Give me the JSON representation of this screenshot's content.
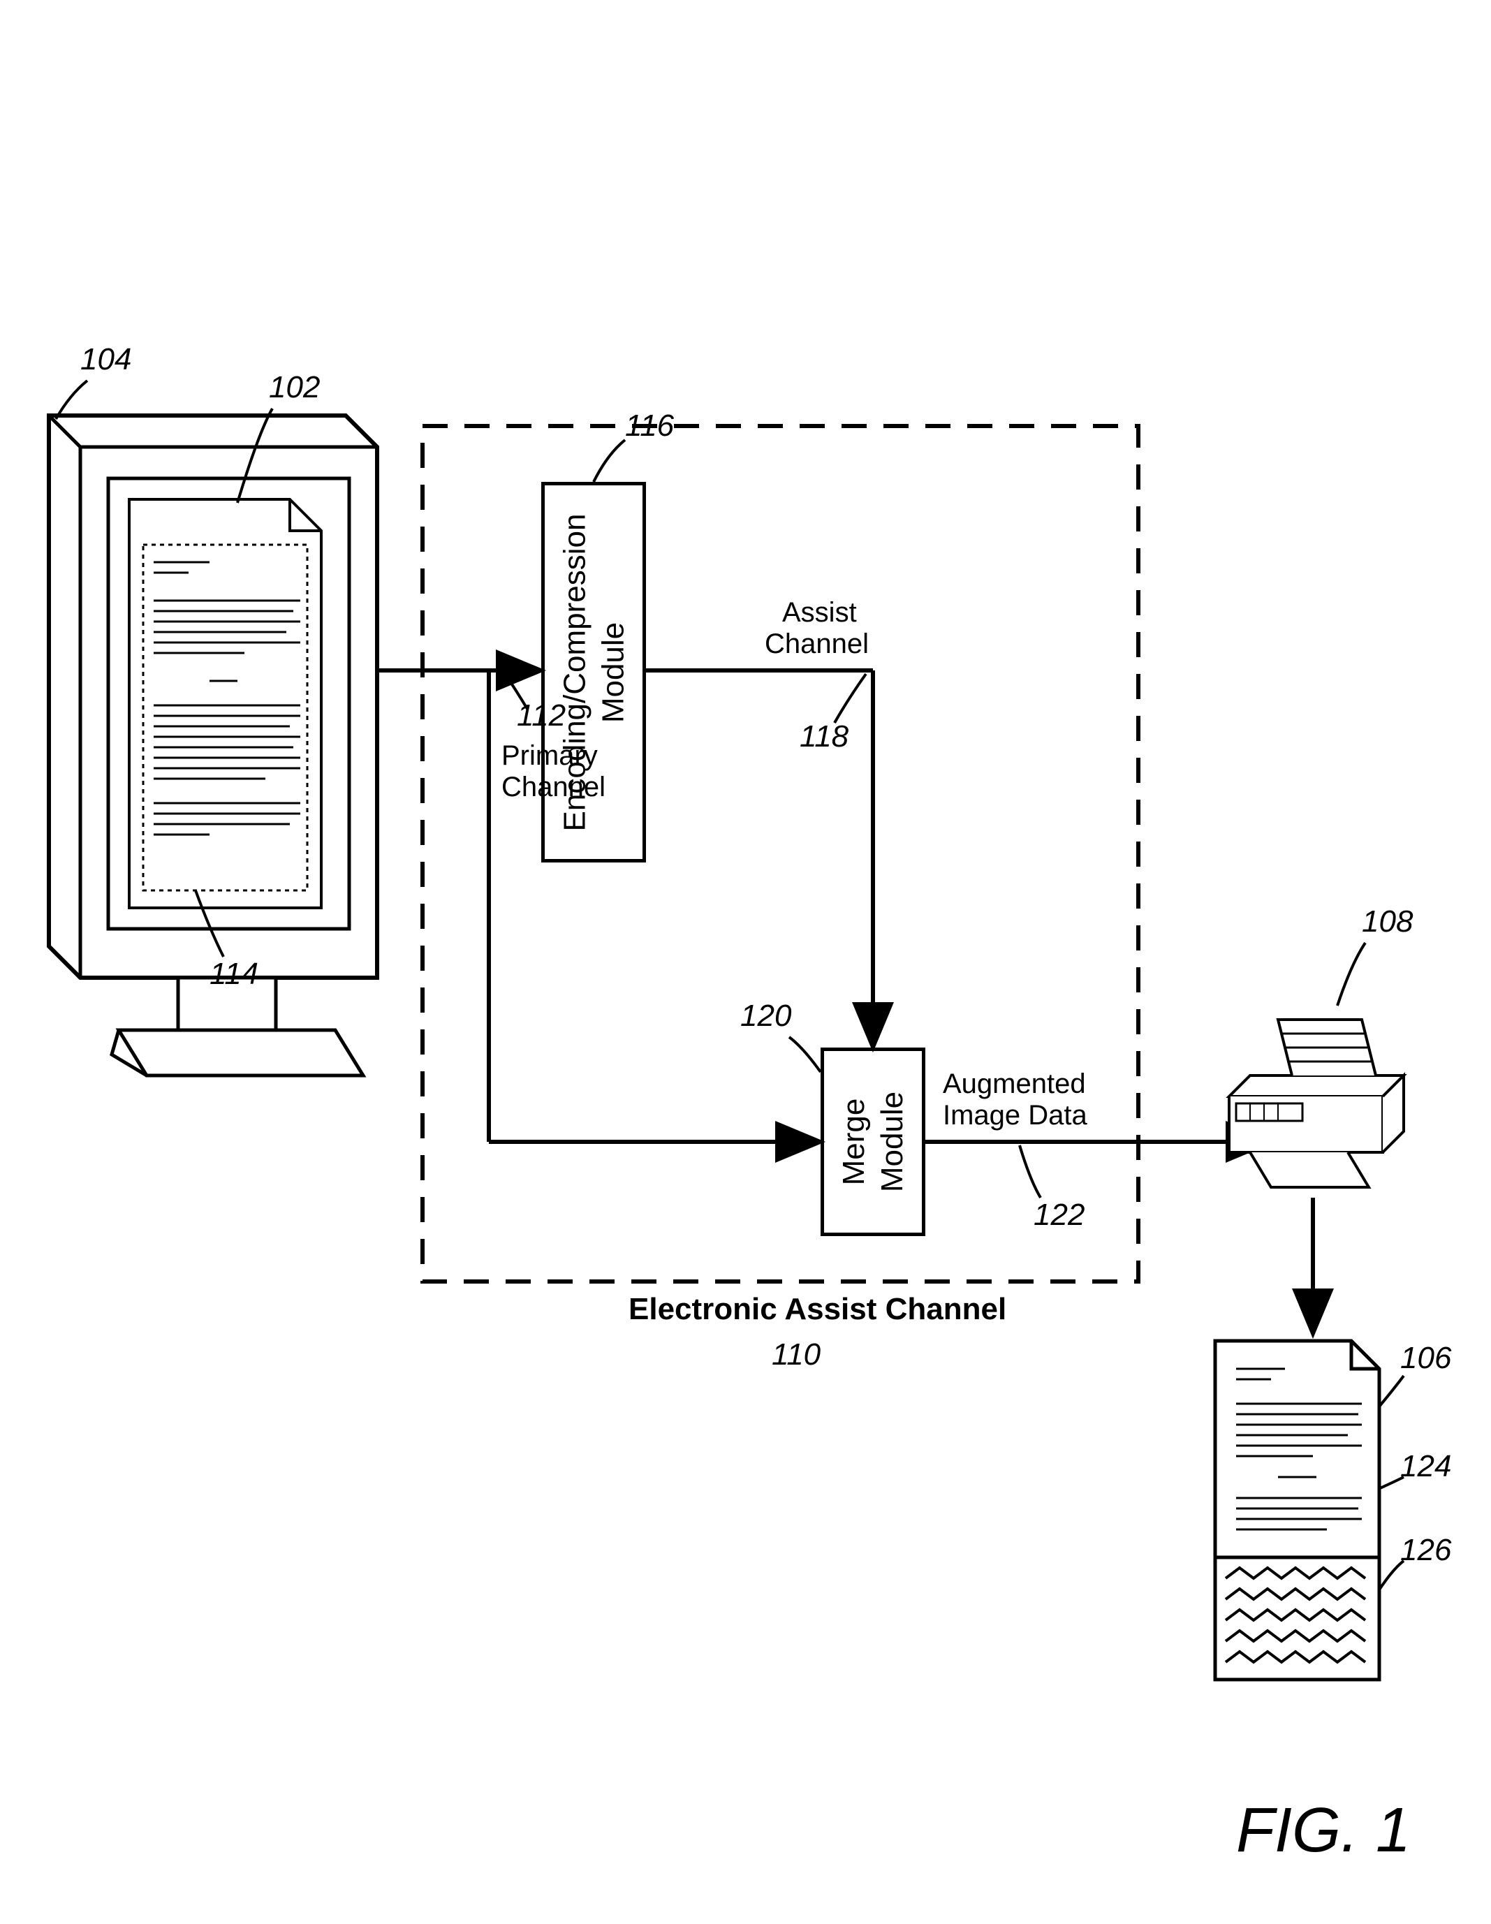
{
  "labels": {
    "l104": "104",
    "l102": "102",
    "l114": "114",
    "l112": "112",
    "l116": "116",
    "l118": "118",
    "l120": "120",
    "l122": "122",
    "l110": "110",
    "l108": "108",
    "l106": "106",
    "l124": "124",
    "l126": "126",
    "primaryChannel1": "Primary",
    "primaryChannel2": "Channel",
    "assistChannel1": "Assist",
    "assistChannel2": "Channel",
    "augmented1": "Augmented",
    "augmented2": "Image Data",
    "eac": "Electronic Assist Channel",
    "encComp1": "Encoding/Compression",
    "encComp2": "Module",
    "merge1": "Merge",
    "merge2": "Module",
    "fig": "FIG. 1"
  }
}
